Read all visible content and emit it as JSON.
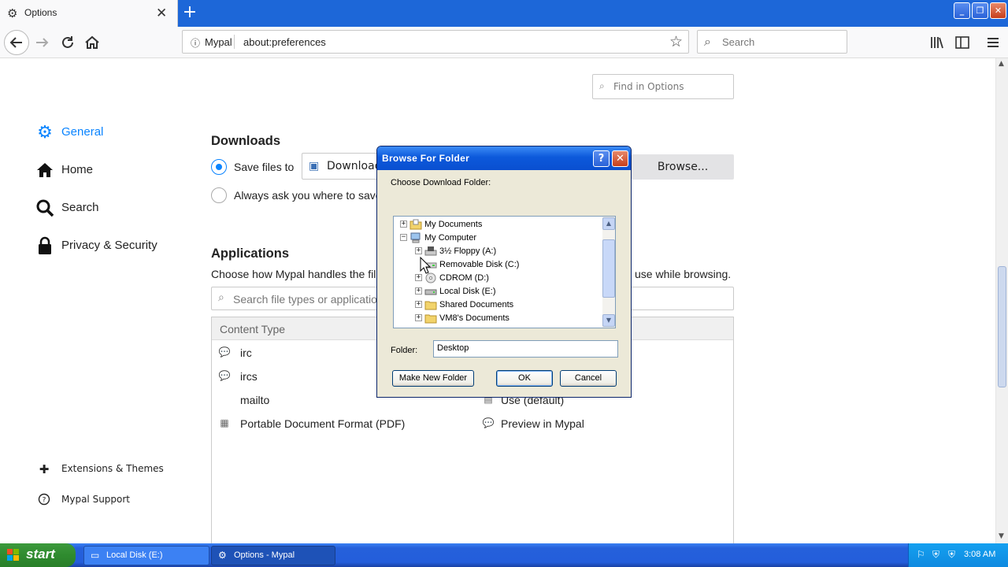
{
  "browser": {
    "tab_title": "Options",
    "tab_close": "✕",
    "new_tab": "+",
    "window_controls": {
      "minimize": "_",
      "maximize": "❐",
      "close": "✕"
    },
    "url_site": "Mypal",
    "url": "about:preferences",
    "search_placeholder": "Search"
  },
  "page": {
    "find_placeholder": "Find in Options",
    "sidebar": [
      {
        "label": "General",
        "icon": "gear-icon"
      },
      {
        "label": "Home",
        "icon": "home-icon"
      },
      {
        "label": "Search",
        "icon": "search-icon"
      },
      {
        "label": "Privacy & Security",
        "icon": "lock-icon"
      }
    ],
    "sidebar_bottom": [
      {
        "label": "Extensions & Themes",
        "icon": "puzzle-icon"
      },
      {
        "label": "Mypal Support",
        "icon": "help-icon"
      }
    ],
    "downloads": {
      "heading": "Downloads",
      "save_files_label": "Save files to",
      "download_field": "Download",
      "always_ask_label": "Always ask you where to save",
      "browse_button": "Browse..."
    },
    "applications": {
      "heading": "Applications",
      "description_left": "Choose how Mypal handles the file",
      "description_right": "use while browsing.",
      "search_placeholder": "Search file types or application",
      "column_content_type": "Content Type",
      "rows": [
        {
          "type": "irc",
          "action": ""
        },
        {
          "type": "ircs",
          "action": ""
        },
        {
          "type": "mailto",
          "action": "Use  (default)"
        },
        {
          "type": "Portable Document Format (PDF)",
          "action": "Preview in Mypal"
        }
      ]
    }
  },
  "dialog": {
    "title": "Browse For Folder",
    "help_button": "?",
    "close_button": "✕",
    "prompt": "Choose Download Folder:",
    "tree": [
      {
        "label": "My Documents",
        "expander": "+",
        "level": 0
      },
      {
        "label": "My Computer",
        "expander": "−",
        "level": 0
      },
      {
        "label": "3½ Floppy (A:)",
        "expander": "+",
        "level": 1
      },
      {
        "label": "Removable Disk (C:)",
        "expander": "",
        "level": 1
      },
      {
        "label": "CDROM (D:)",
        "expander": "+",
        "level": 1
      },
      {
        "label": "Local Disk (E:)",
        "expander": "+",
        "level": 1
      },
      {
        "label": "Shared Documents",
        "expander": "+",
        "level": 1
      },
      {
        "label": "VM8's Documents",
        "expander": "+",
        "level": 1
      }
    ],
    "folder_label": "Folder:",
    "folder_value": "Desktop",
    "make_new_folder": "Make New Folder",
    "ok": "OK",
    "cancel": "Cancel"
  },
  "taskbar": {
    "start": "start",
    "items": [
      {
        "label": "Local Disk (E:)"
      },
      {
        "label": "Options - Mypal"
      }
    ],
    "clock": "3:08 AM"
  }
}
